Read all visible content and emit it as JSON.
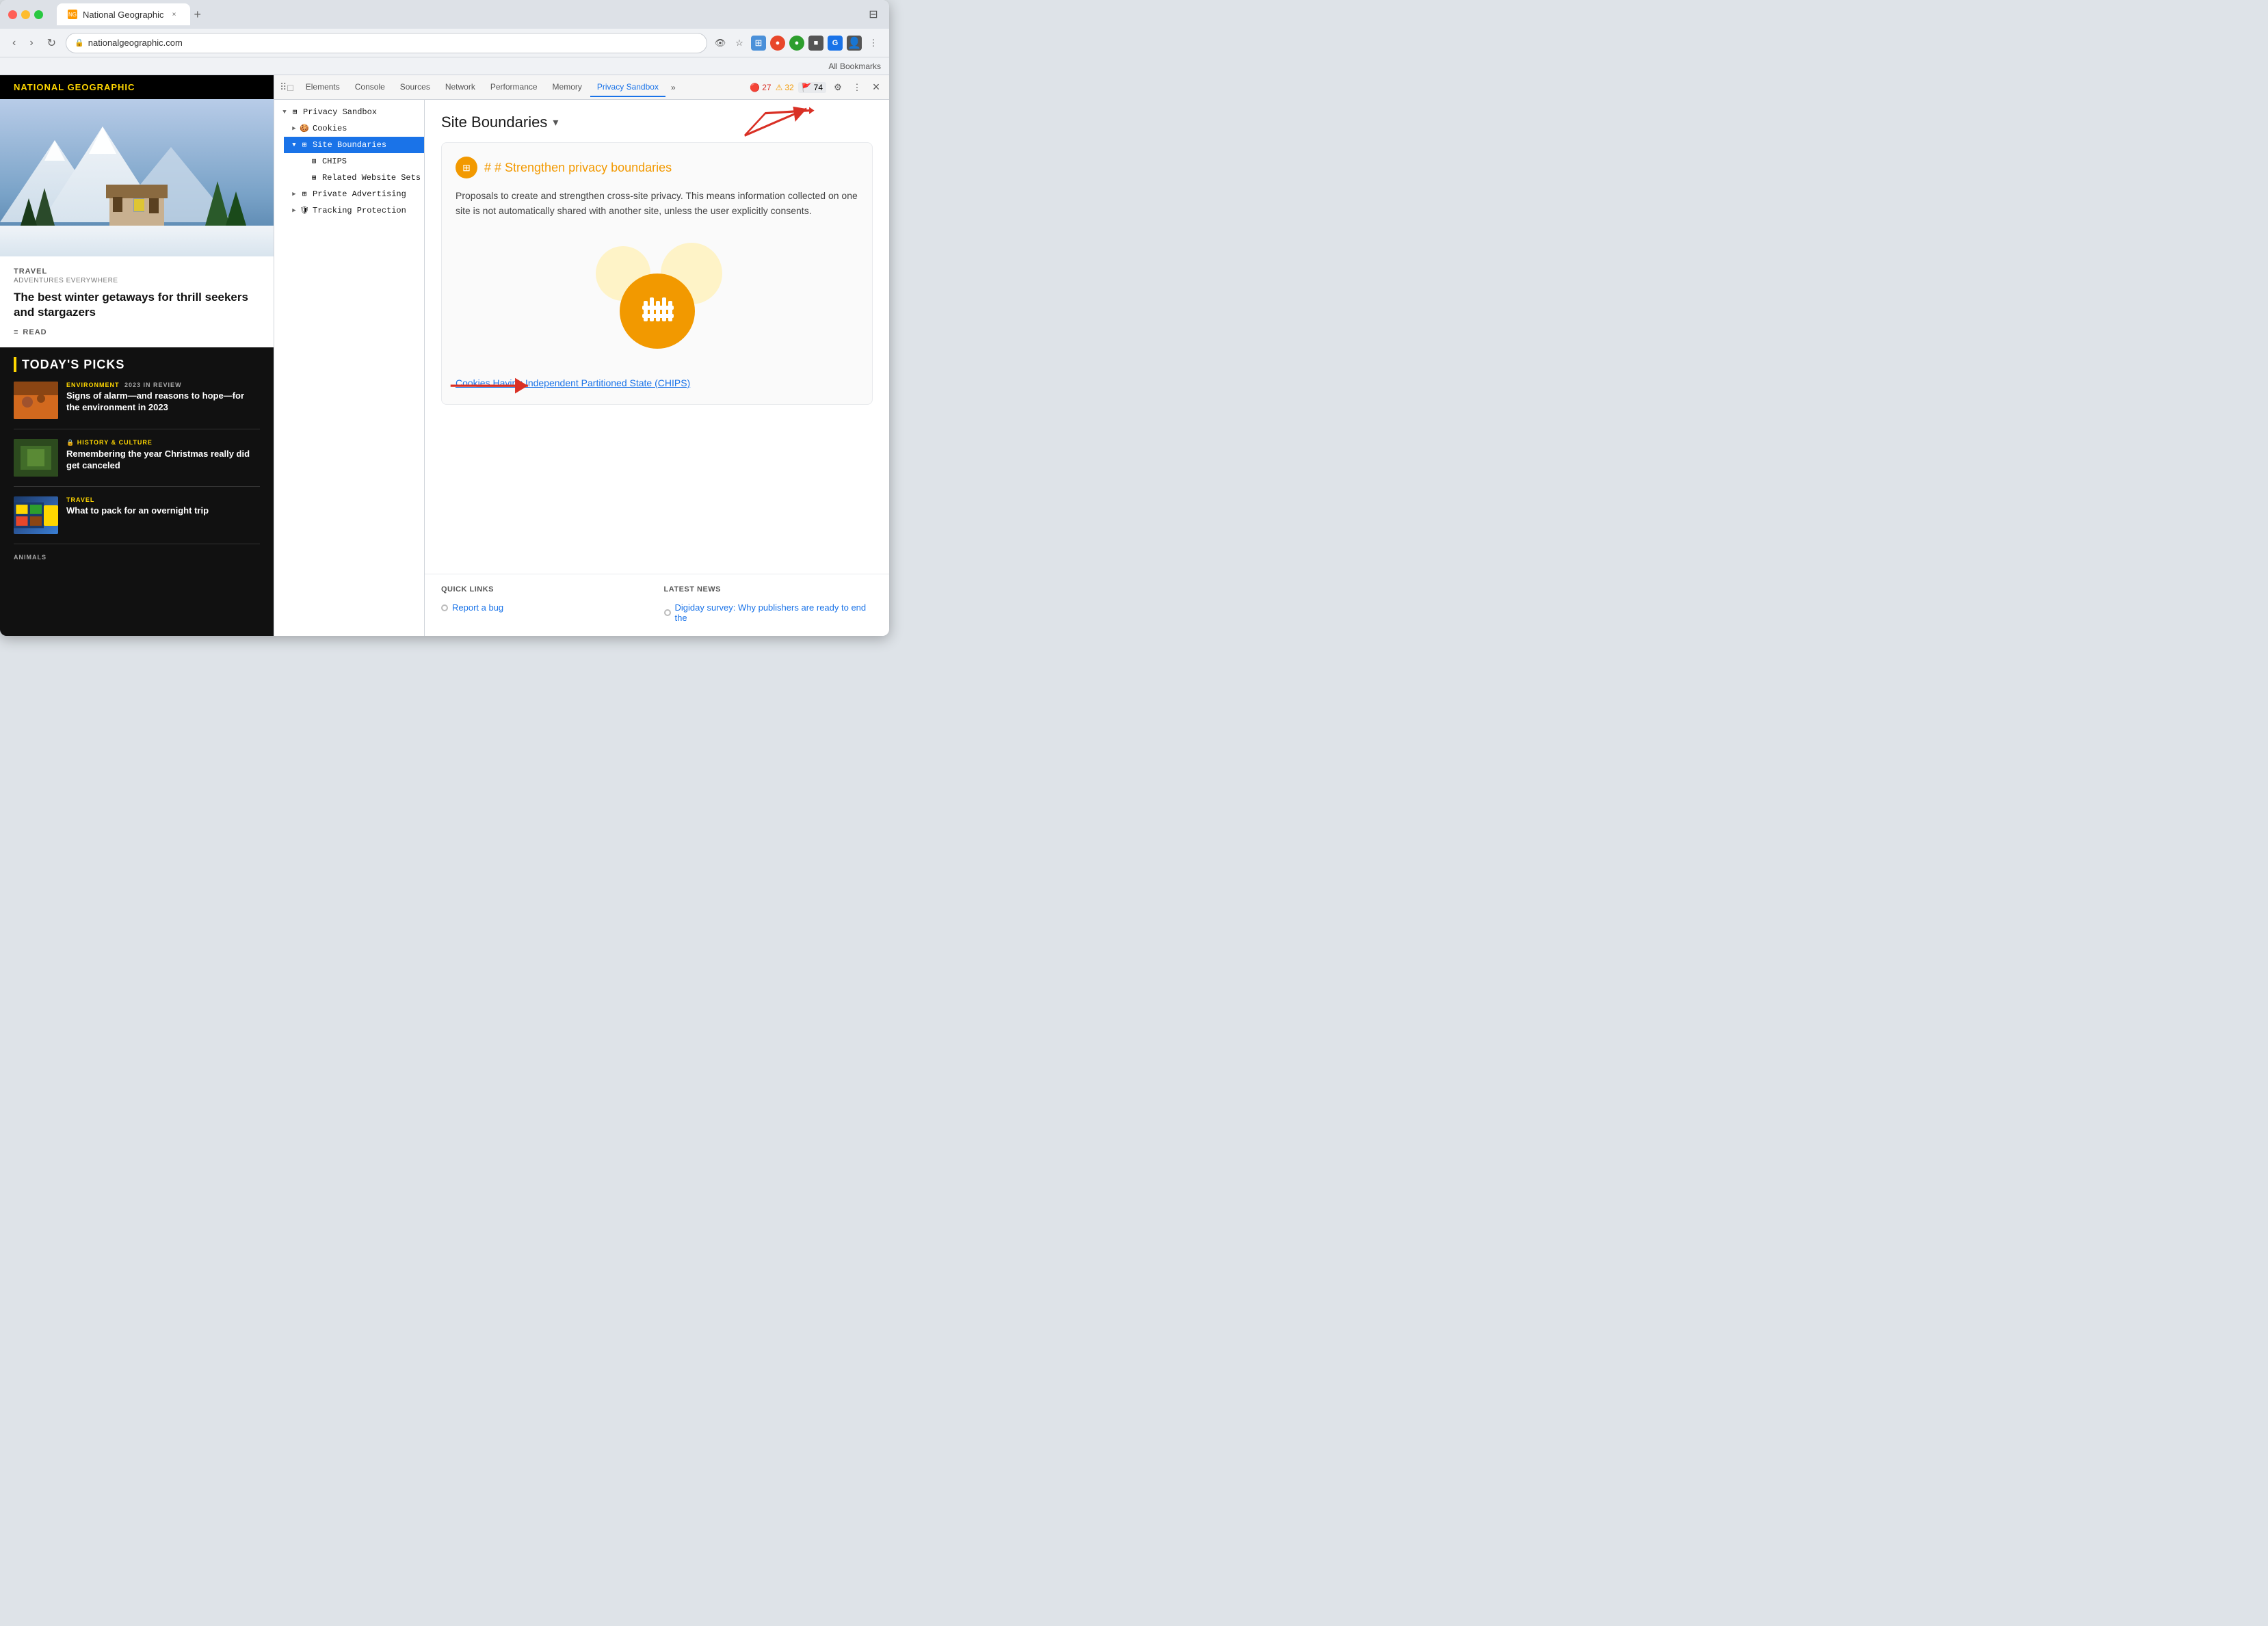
{
  "browser": {
    "tab_title": "National Geographic",
    "tab_favicon": "NG",
    "address": "nationalgeographic.com",
    "bookmarks_label": "All Bookmarks"
  },
  "devtools": {
    "tabs": [
      "Elements",
      "Console",
      "Sources",
      "Network",
      "Performance",
      "Memory",
      "Privacy Sandbox"
    ],
    "active_tab": "Privacy Sandbox",
    "more_label": "»",
    "error_count": "27",
    "warning_count": "32",
    "info_count": "74",
    "close_label": "×",
    "tree": {
      "items": [
        {
          "label": "Privacy Sandbox",
          "level": 0,
          "expandable": true,
          "icon": "⊞"
        },
        {
          "label": "Cookies",
          "level": 1,
          "expandable": true,
          "icon": "🍪"
        },
        {
          "label": "Site Boundaries",
          "level": 1,
          "expandable": true,
          "icon": "⊞",
          "selected": true
        },
        {
          "label": "CHIPS",
          "level": 2,
          "expandable": false,
          "icon": "⊞"
        },
        {
          "label": "Related Website Sets",
          "level": 2,
          "expandable": false,
          "icon": "⊞"
        },
        {
          "label": "Private Advertising",
          "level": 1,
          "expandable": true,
          "icon": "⊞"
        },
        {
          "label": "Tracking Protection",
          "level": 1,
          "expandable": true,
          "icon": "🛡"
        }
      ]
    },
    "content": {
      "page_title": "Site Boundaries",
      "page_title_arrow": "▾",
      "card": {
        "icon_label": "⊞",
        "title": "Strengthen privacy boundaries",
        "body": "Proposals to create and strengthen cross-site privacy. This means information collected on one site is not automatically shared with another site, unless the user explicitly consents."
      },
      "link_text": "Cookies Having Independent Partitioned State (CHIPS)",
      "bottom": {
        "quick_links_title": "QUICK LINKS",
        "latest_news_title": "LATEST NEWS",
        "quick_links": [
          {
            "label": "Report a bug"
          }
        ],
        "latest_news": [
          {
            "label": "Digiday survey: Why publishers are ready to end the"
          }
        ]
      }
    }
  },
  "ng": {
    "logo": "National Geographic",
    "hero": {
      "tag": "TRAVEL",
      "subtitle": "ADVENTURES EVERYWHERE",
      "headline": "The best winter getaways for thrill seekers and stargazers",
      "read_label": "READ"
    },
    "picks_title": "TODAY'S PICKS",
    "items": [
      {
        "category": "ENVIRONMENT",
        "badge": "2023 IN REVIEW",
        "title": "Signs of alarm—and reasons to hope—for the environment in 2023",
        "thumb_class": "thumb-env"
      },
      {
        "category": "HISTORY & CULTURE",
        "badge": "",
        "title": "Remembering the year Christmas really did get canceled",
        "thumb_class": "thumb-hist"
      },
      {
        "category": "TRAVEL",
        "badge": "",
        "title": "What to pack for an overnight trip",
        "thumb_class": "thumb-travel"
      }
    ],
    "animals_label": "ANIMALS"
  }
}
